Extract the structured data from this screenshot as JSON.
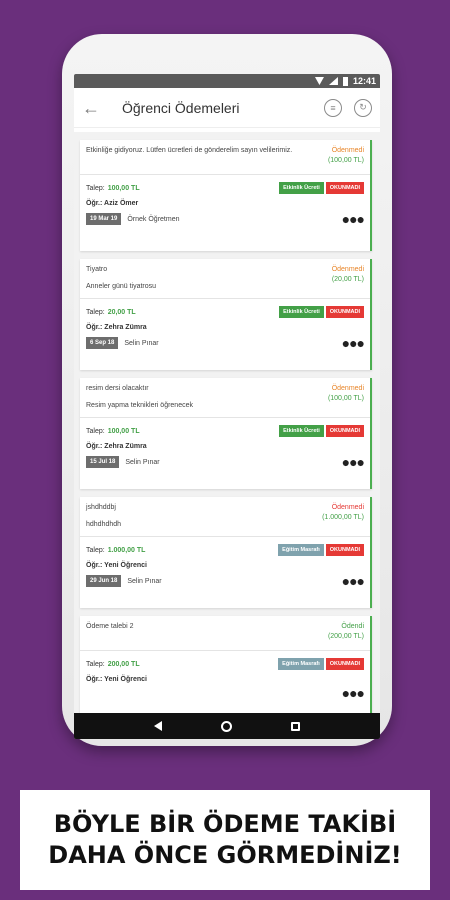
{
  "statusbar": {
    "time": "12:41"
  },
  "appbar": {
    "title": "Öğrenci Ödemeleri",
    "back_icon": "arrow-left-icon",
    "filter_icon": "list-circle-icon",
    "refresh_icon": "refresh-icon"
  },
  "labels": {
    "talep": "Talep:",
    "ogr": "Öğr.:"
  },
  "cards": [
    {
      "desc": "Etkinliğe gidiyoruz. Lütfen ücretleri de gönderelim sayın velilerimiz.",
      "desc2": "",
      "status": "Ödenmedi",
      "status_class": "orange",
      "amount_text": "(100,00 TL)",
      "amount_class": "green",
      "talep": "100,00 TL",
      "badge_type": "Etkinlik Ücreti",
      "badge_class": "b-green",
      "read": "OKUNMADI",
      "student": "Aziz Ömer",
      "date": "19 Mar 19",
      "teacher": "Örnek Öğretmen"
    },
    {
      "desc": "Tiyatro",
      "desc2": "Anneler günü tiyatrosu",
      "status": "Ödenmedi",
      "status_class": "orange",
      "amount_text": "(20,00 TL)",
      "amount_class": "green",
      "talep": "20,00 TL",
      "badge_type": "Etkinlik Ücreti",
      "badge_class": "b-green",
      "read": "OKUNMADI",
      "student": "Zehra Zümra",
      "date": "6 Sep 18",
      "teacher": "Selin Pınar"
    },
    {
      "desc": "resim dersi olacaktır",
      "desc2": "Resim yapma teknikleri öğrenecek",
      "status": "Ödenmedi",
      "status_class": "orange",
      "amount_text": "(100,00 TL)",
      "amount_class": "green",
      "talep": "100,00 TL",
      "badge_type": "Etkinlik Ücreti",
      "badge_class": "b-green",
      "read": "OKUNMADI",
      "student": "Zehra Zümra",
      "date": "15 Jul 18",
      "teacher": "Selin Pınar"
    },
    {
      "desc": "jshdhddbj",
      "desc2": "hdhdhdhdh",
      "status": "Ödenmedi",
      "status_class": "red",
      "amount_text": "(1.000,00 TL)",
      "amount_class": "green",
      "talep": "1.000,00 TL",
      "badge_type": "Eğitim Masrafı",
      "badge_class": "b-grey",
      "read": "OKUNMADI",
      "student": "Yeni Öğrenci",
      "date": "29 Jun 18",
      "teacher": "Selin Pınar"
    },
    {
      "desc": "Ödeme talebi 2",
      "desc2": "",
      "status": "Ödendi",
      "status_class": "green",
      "amount_text": "(200,00 TL)",
      "amount_class": "green",
      "talep": "200,00 TL",
      "badge_type": "Eğitim Masrafı",
      "badge_class": "b-grey",
      "read": "OKUNMADI",
      "student": "Yeni Öğrenci",
      "date": "",
      "teacher": ""
    }
  ],
  "banner": {
    "line1": "BÖYLE BİR ÖDEME TAKİBİ",
    "line2": "DAHA ÖNCE GÖRMEDİNİZ!"
  }
}
